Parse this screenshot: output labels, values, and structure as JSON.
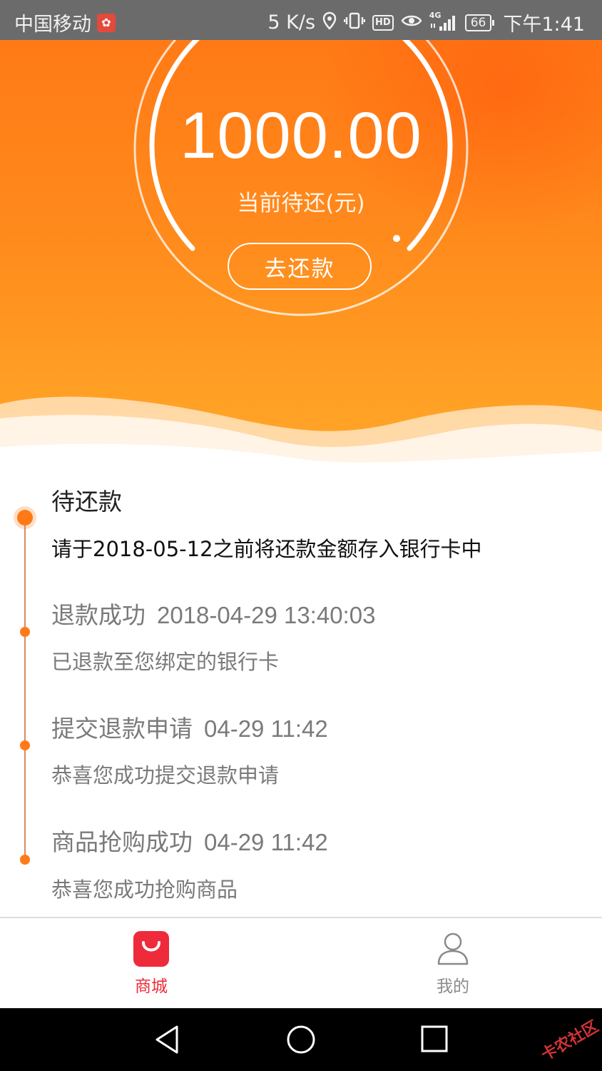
{
  "status_bar": {
    "carrier": "中国移动",
    "net_speed": "5 K/s",
    "network": "4G",
    "hd": "HD",
    "battery": "66",
    "time": "下午1:41"
  },
  "hero": {
    "amount": "1000.00",
    "amount_label": "当前待还(元)",
    "repay_button": "去还款",
    "colors": {
      "gradient_top": "#ff7a16",
      "gradient_bottom": "#ffa52a"
    }
  },
  "timeline": [
    {
      "title": "待还款",
      "time": "",
      "desc": "请于2018-05-12之前将还款金额存入银行卡中",
      "active": true
    },
    {
      "title": "退款成功",
      "time": "2018-04-29 13:40:03",
      "desc": "已退款至您绑定的银行卡",
      "active": false
    },
    {
      "title": "提交退款申请",
      "time": "04-29 11:42",
      "desc": "恭喜您成功提交退款申请",
      "active": false
    },
    {
      "title": "商品抢购成功",
      "time": "04-29 11:42",
      "desc": "恭喜您成功抢购商品",
      "active": false
    }
  ],
  "tabbar": {
    "items": [
      {
        "label": "商城",
        "icon": "shopping-bag-icon",
        "selected": true
      },
      {
        "label": "我的",
        "icon": "user-icon",
        "selected": false
      }
    ],
    "accent": "#ee2b3a"
  },
  "navbar": {
    "buttons": [
      "back",
      "home",
      "recents"
    ],
    "watermark": "卡农社区"
  }
}
